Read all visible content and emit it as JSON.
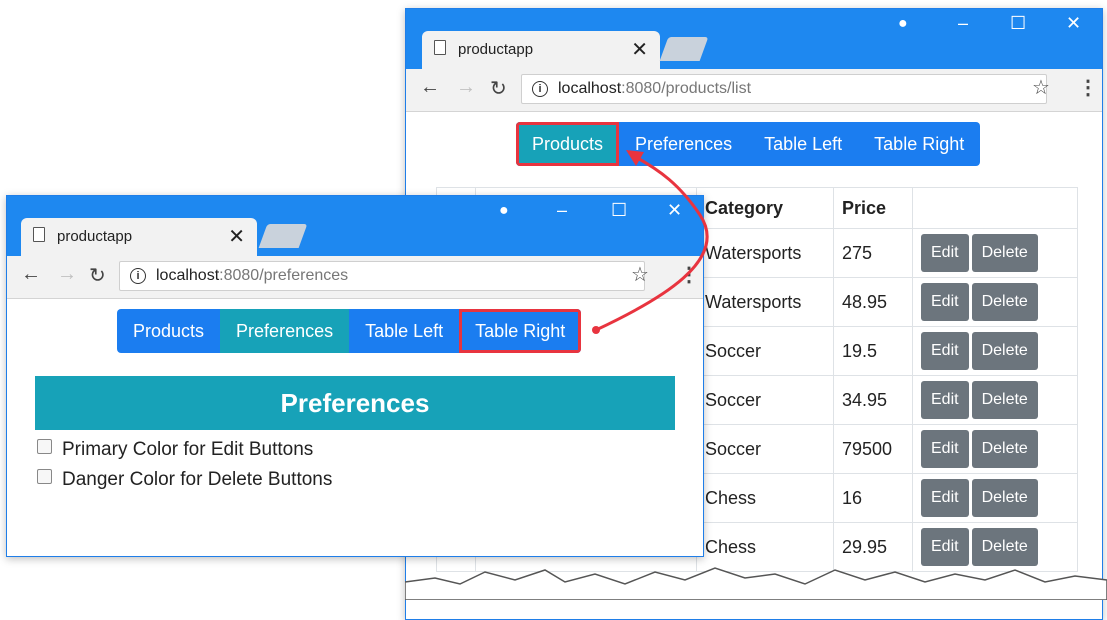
{
  "back_window": {
    "tab_title": "productapp",
    "url_host": "localhost",
    "url_rest": ":8080/products/list",
    "nav": [
      "Products",
      "Preferences",
      "Table Left",
      "Table Right"
    ],
    "table": {
      "headers": [
        "Category",
        "Price"
      ],
      "rows": [
        {
          "category": "Watersports",
          "price": "275"
        },
        {
          "category": "Watersports",
          "price": "48.95"
        },
        {
          "category": "Soccer",
          "price": "19.5"
        },
        {
          "category": "Soccer",
          "price": "34.95"
        },
        {
          "category": "Soccer",
          "price": "79500"
        },
        {
          "category": "Chess",
          "price": "16"
        },
        {
          "category": "Chess",
          "price": "29.95"
        }
      ],
      "edit_label": "Edit",
      "delete_label": "Delete"
    }
  },
  "front_window": {
    "tab_title": "productapp",
    "url_host": "localhost",
    "url_rest": ":8080/preferences",
    "nav": [
      "Products",
      "Preferences",
      "Table Left",
      "Table Right"
    ],
    "page_title": "Preferences",
    "options": [
      "Primary Color for Edit Buttons",
      "Danger Color for Delete Buttons"
    ]
  },
  "icons": {
    "page": "page-icon",
    "close": "close-icon",
    "user": "user-icon",
    "minimize": "minimize-icon",
    "maximize": "maximize-icon",
    "back": "back-arrow-icon",
    "forward": "forward-arrow-icon",
    "reload": "reload-icon",
    "info": "info-icon",
    "star": "star-icon",
    "menu": "menu-icon"
  },
  "colors": {
    "titlebar": "#1e88f0",
    "nav": "#1b7df0",
    "active": "#17a2b8",
    "highlight": "#e8343f",
    "button": "#6c757d"
  }
}
